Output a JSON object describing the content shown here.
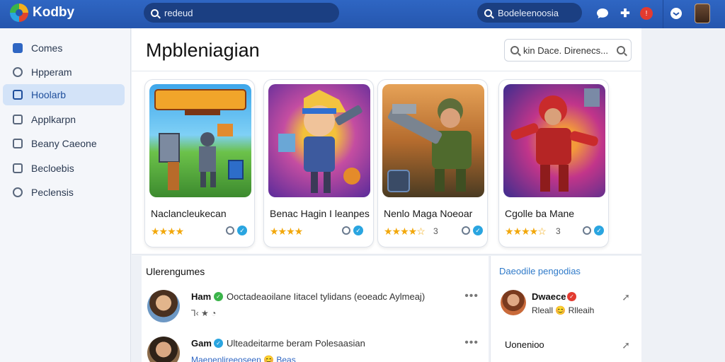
{
  "app": {
    "name": "Kodby"
  },
  "topbar": {
    "search_value": "redeud",
    "search2_value": "Bodeleenoosia",
    "icons": [
      "chat-icon",
      "plus-icon",
      "notification-icon",
      "inbox-icon"
    ],
    "notification_badge": "!"
  },
  "sidebar": {
    "items": [
      {
        "label": "Comes",
        "icon": "checkbox-icon"
      },
      {
        "label": "Hpperam",
        "icon": "shield-icon"
      },
      {
        "label": "Hoolarb",
        "icon": "square-icon",
        "active": true
      },
      {
        "label": "Applkarpn",
        "icon": "grid-icon"
      },
      {
        "label": "Beany Caeone",
        "icon": "list-icon"
      },
      {
        "label": "Becloebis",
        "icon": "box-icon"
      },
      {
        "label": "Peclensis",
        "icon": "gear-icon"
      }
    ]
  },
  "main": {
    "title": "Mpbleniagian",
    "filter_placeholder": "kin Dace. Direnecs...",
    "cards": [
      {
        "title": "Naclancleukecan",
        "stars": "★★★★",
        "rating": ""
      },
      {
        "title": "Benac Hagin I leanpes",
        "stars": "★★★★",
        "rating": ""
      },
      {
        "title": "Nenlo Maga Noeoar",
        "stars": "★★★★☆",
        "rating": "3"
      },
      {
        "title": "Cgolle ba Mane",
        "stars": "★★★★☆",
        "rating": "3"
      }
    ]
  },
  "feed": {
    "title": "Ulerengumes",
    "posts": [
      {
        "name": "Ham",
        "text": "Ooctadeaoilane Iitacel tylidans (eoeadc Aylmeaj)",
        "sub": "Ꞁ‹ ★ ◔",
        "verify_color": "#3bb44a"
      },
      {
        "name": "Gam",
        "text": "Ulteadeitarme beram  Polesaasian",
        "sub": "Maenenlireeoseen  😊  Beas",
        "verify_color": "#2aa5e0"
      }
    ]
  },
  "side_panel": {
    "title": "Daeodile pengodias",
    "entries": [
      {
        "name": "Dwaece",
        "sub": "Rleall 😊 Rlleaih"
      },
      {
        "name": "Uonenioo",
        "sub": ""
      }
    ]
  },
  "colors": {
    "topbar": "#2f66c3",
    "accent": "#2f66c3",
    "star": "#f2a80c"
  }
}
